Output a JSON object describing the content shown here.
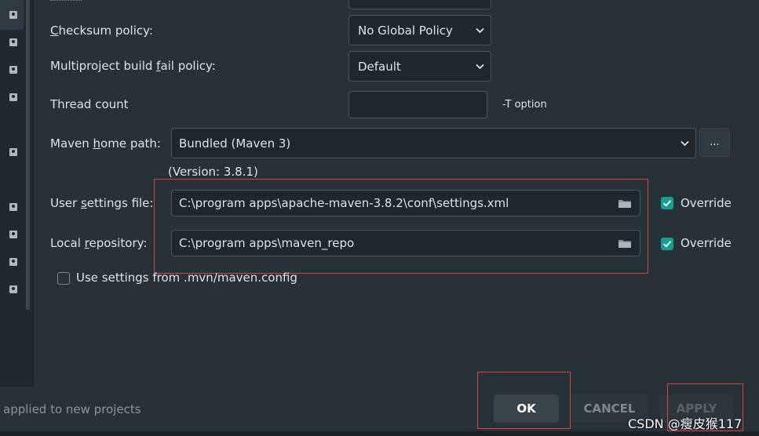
{
  "settings": {
    "checksum_policy_label_pre": "",
    "checksum_policy_label_u": "C",
    "checksum_policy_label_post": "hecksum policy:",
    "checksum_policy_value": "No Global Policy",
    "multiproject_label_pre": "Multiproject build ",
    "multiproject_label_u": "f",
    "multiproject_label_post": "ail policy:",
    "multiproject_value": "Default",
    "thread_count_label": "Thread count",
    "thread_count_value": "",
    "thread_count_hint": "-T option",
    "maven_home_label_pre": "Maven ",
    "maven_home_label_u": "h",
    "maven_home_label_post": "ome path:",
    "maven_home_value": "Bundled (Maven 3)",
    "browse_label": "...",
    "maven_version": "(Version: 3.8.1)",
    "user_settings_label_pre": "User ",
    "user_settings_label_u": "s",
    "user_settings_label_post": "ettings file:",
    "user_settings_value": "C:\\program apps\\apache-maven-3.8.2\\conf\\settings.xml",
    "override_label": "Override",
    "local_repo_label_pre": "Local ",
    "local_repo_label_u": "r",
    "local_repo_label_post": "epository:",
    "local_repo_value": "C:\\program apps\\maven_repo",
    "use_mvn_config_label": "Use settings from .mvn/maven.config",
    "user_settings_override": true,
    "local_repo_override": true,
    "use_mvn_config": false
  },
  "footer": {
    "note": "applied to new projects",
    "ok_label": "OK",
    "cancel_label": "CANCEL",
    "apply_label": "APPLY",
    "watermark": "CSDN @瘦皮猴117"
  },
  "colors": {
    "background": "#263238",
    "accent_check": "#13a091",
    "highlight_box": "#e04040"
  }
}
